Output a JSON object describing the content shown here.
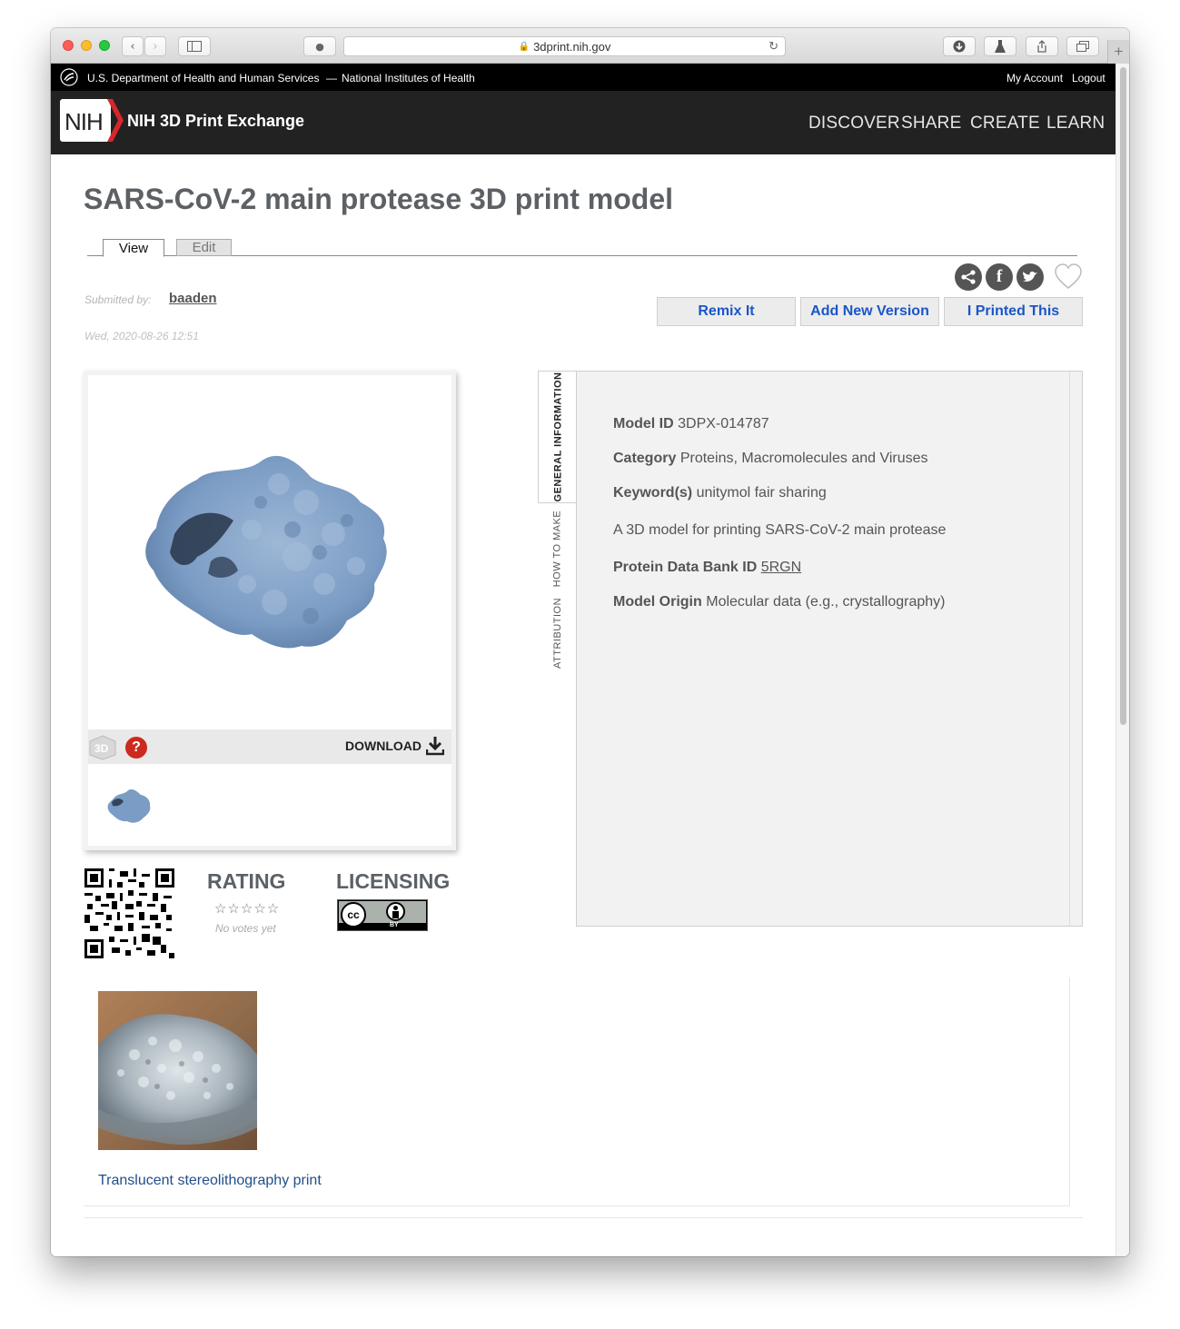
{
  "browser": {
    "url": "3dprint.nih.gov"
  },
  "hhs_bar": {
    "left_text": "U.S. Department of Health and Human Services",
    "separator": "—",
    "nih_text": "National Institutes of Health",
    "my_account": "My Account",
    "logout": "Logout"
  },
  "site": {
    "logo_text": "NIH",
    "name": "NIH 3D Print Exchange",
    "nav": [
      "DISCOVER",
      "SHARE",
      "CREATE",
      "LEARN"
    ]
  },
  "page": {
    "title": "SARS-CoV-2 main protease 3D print model",
    "tabs": {
      "view": "View",
      "edit": "Edit"
    },
    "submitted_by_label": "Submitted by:",
    "submitter": "baaden",
    "date": "Wed, 2020-08-26 12:51",
    "actions": {
      "remix": "Remix It",
      "new_version": "Add New Version",
      "printed": "I Printed This"
    }
  },
  "viewer": {
    "download_label": "DOWNLOAD",
    "viewer_3d_label": "3D",
    "help_label": "?"
  },
  "rating": {
    "heading": "RATING",
    "stars": "☆☆☆☆☆",
    "votes": "No votes yet"
  },
  "licensing": {
    "heading": "LICENSING",
    "badge_cc": "cc",
    "badge_by": "BY"
  },
  "info_tabs": {
    "general": "GENERAL INFORMATION",
    "how_to_make": "HOW TO MAKE",
    "attribution": "ATTRIBUTION"
  },
  "info": {
    "model_id_label": "Model ID",
    "model_id": "3DPX-014787",
    "category_label": "Category",
    "category": "Proteins, Macromolecules and Viruses",
    "keywords_label": "Keyword(s)",
    "keywords": "unitymol fair sharing",
    "description": "A 3D model for printing SARS-CoV-2 main protease",
    "pdb_label": "Protein Data Bank ID",
    "pdb_id": "5RGN",
    "origin_label": "Model Origin",
    "origin": "Molecular data (e.g., crystallography)"
  },
  "gallery": {
    "caption": "Translucent stereolithography print"
  },
  "colors": {
    "protein_blue": "#7b9cc4",
    "nih_red": "#d8262b",
    "link_blue": "#1a56c8"
  }
}
